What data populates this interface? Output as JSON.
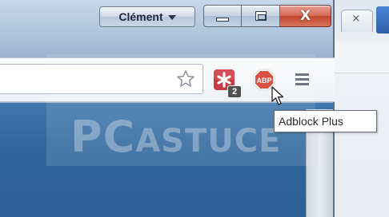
{
  "titlebar": {
    "profile_name": "Clément"
  },
  "toolbar": {
    "ext_red_badge": "2",
    "abp_label": "ABP"
  },
  "tooltip": {
    "text": "Adblock Plus"
  },
  "background_window": {
    "tab_close": "×"
  },
  "watermark": {
    "text_big": "PC",
    "text_small": "ASTUCE"
  },
  "icons": {
    "star": "star-icon",
    "menu": "hamburger-menu-icon",
    "close": "close-icon"
  },
  "colors": {
    "abp_red": "#d8372b",
    "ext_red": "#c0212e",
    "page_blue": "#2f669c"
  }
}
